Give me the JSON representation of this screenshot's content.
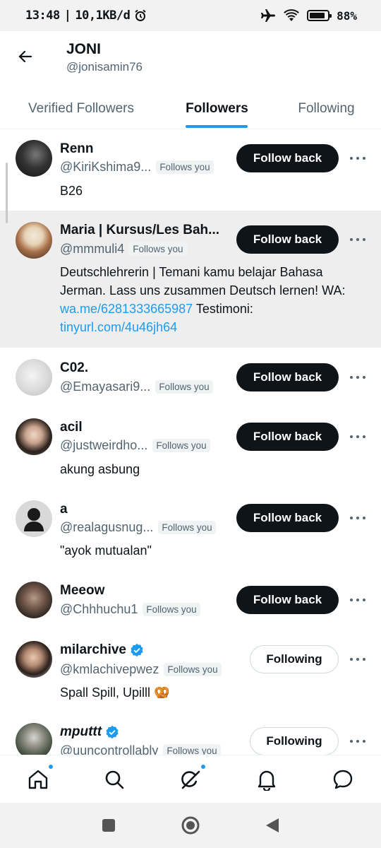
{
  "status_bar": {
    "time": "13:48",
    "speed": "10,1KB/d",
    "battery": "88%",
    "battery_level": 0.88
  },
  "header": {
    "name": "JONI",
    "handle": "@jonisamin76"
  },
  "tabs": [
    {
      "label": "Verified Followers",
      "active": false
    },
    {
      "label": "Followers",
      "active": true
    },
    {
      "label": "Following",
      "active": false
    }
  ],
  "follows_you_label": "Follows you",
  "users": [
    {
      "name": "Renn",
      "handle": "@KiriKshima9...",
      "bio": "B26",
      "button": "Follow back",
      "verified": false
    },
    {
      "name": "Maria | Kursus/Les Bah...",
      "handle": "@mmmuli4",
      "bio_text": "Deutschlehrerin | Temani kamu belajar Bahasa Jerman. Lass uns zusammen Deutsch lernen! WA: ",
      "bio_link1": "wa.me/6281333665987",
      "bio_mid": " Testimoni: ",
      "bio_link2": "tinyurl.com/4u46jh64",
      "button": "Follow back",
      "verified": false
    },
    {
      "name": "C02.",
      "handle": "@Emayasari9...",
      "bio": "",
      "button": "Follow back",
      "verified": false
    },
    {
      "name": "acil",
      "handle": "@justweirdho...",
      "bio": "akung asbung",
      "button": "Follow back",
      "verified": false
    },
    {
      "name": "a",
      "handle": "@realagusnug...",
      "bio": "\"ayok mutualan\"",
      "button": "Follow back",
      "verified": false
    },
    {
      "name": "Meeow",
      "handle": "@Chhhuchu1",
      "bio": "",
      "button": "Follow back",
      "verified": false
    },
    {
      "name": "milarchive",
      "handle": "@kmlachivepwez",
      "bio": "Spall Spill, Upilll 🥨",
      "button": "Following",
      "verified": true
    },
    {
      "name": "mputtt",
      "handle": "@uuncontrollably",
      "bio": "",
      "button": "Following",
      "verified": true
    }
  ],
  "colors": {
    "accent": "#1d9bf0",
    "text": "#0f1419",
    "secondary": "#536471",
    "highlight_row": "#eeeeee"
  },
  "icons": {
    "back": "arrow-left-icon",
    "more": "more-horizontal-icon",
    "nav": [
      "home-icon",
      "search-icon",
      "grok-icon",
      "notifications-icon",
      "messages-icon"
    ],
    "system": [
      "recents-icon",
      "home-circle-icon",
      "back-triangle-icon"
    ]
  }
}
